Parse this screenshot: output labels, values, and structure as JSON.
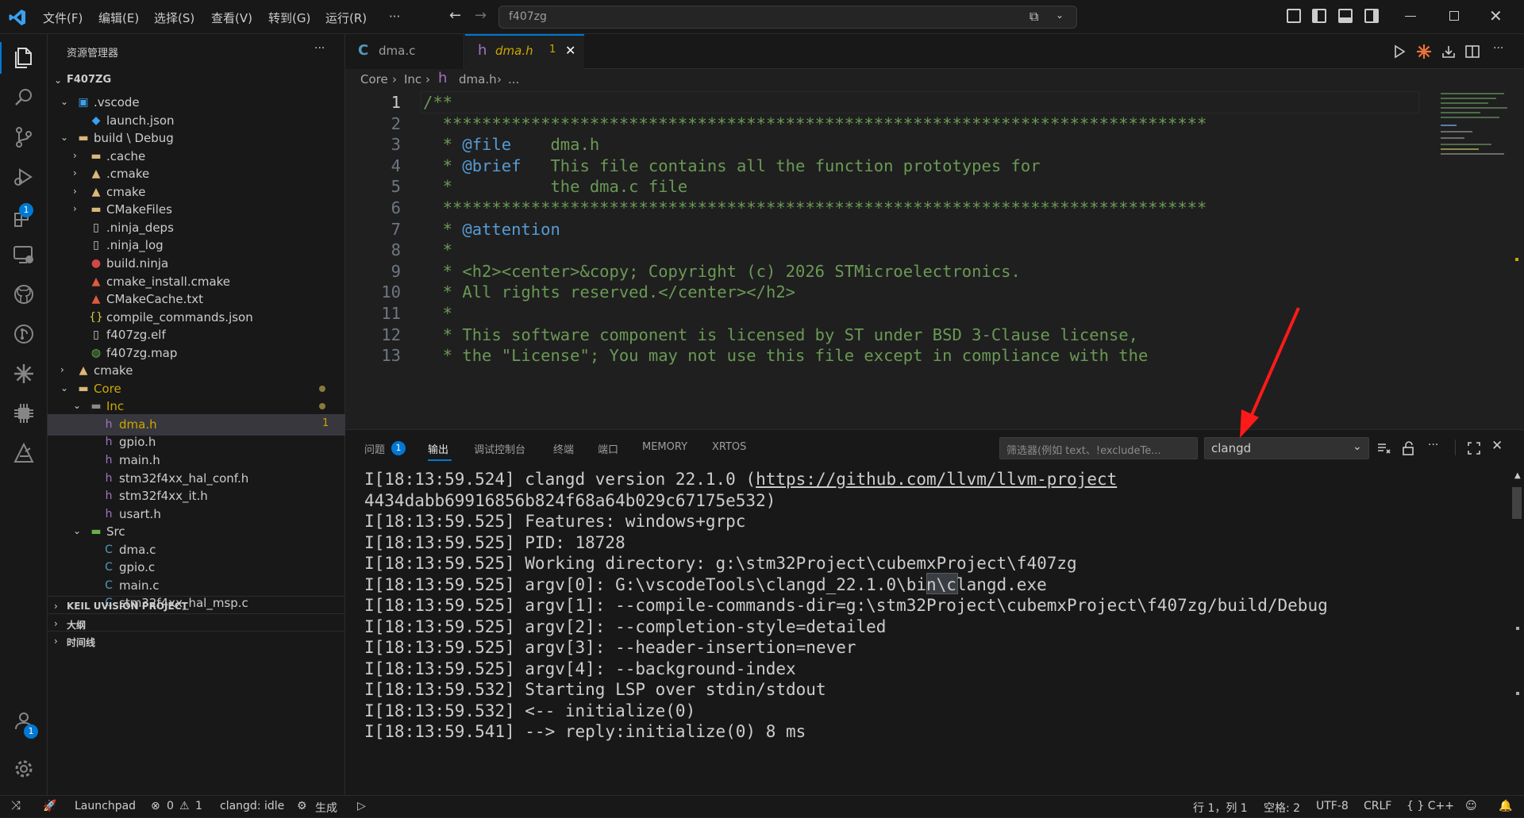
{
  "titlebar": {
    "menus": [
      "文件(F)",
      "编辑(E)",
      "选择(S)",
      "查看(V)",
      "转到(G)",
      "运行(R)",
      "···"
    ],
    "search_text": "f407zg"
  },
  "activity": {
    "extensions_badge": "1",
    "accounts_badge": "1"
  },
  "sidebar": {
    "title": "资源管理器",
    "more": "···",
    "root": "F407ZG",
    "items": [
      {
        "label": ".vscode",
        "depth": 1,
        "chev": "open",
        "icon": "vscode-folder-icon"
      },
      {
        "label": "launch.json",
        "depth": 2,
        "chev": "none",
        "icon": "vscode-file-icon"
      },
      {
        "label": "build \\ Debug",
        "depth": 1,
        "chev": "open",
        "icon": "folder-icon"
      },
      {
        "label": ".cache",
        "depth": 2,
        "chev": "closed",
        "icon": "folder-icon"
      },
      {
        "label": ".cmake",
        "depth": 2,
        "chev": "closed",
        "icon": "cmake-folder-icon"
      },
      {
        "label": "cmake",
        "depth": 2,
        "chev": "closed",
        "icon": "cmake-folder-icon"
      },
      {
        "label": "CMakeFiles",
        "depth": 2,
        "chev": "closed",
        "icon": "folder-icon"
      },
      {
        "label": ".ninja_deps",
        "depth": 2,
        "chev": "none",
        "icon": "file-icon"
      },
      {
        "label": ".ninja_log",
        "depth": 2,
        "chev": "none",
        "icon": "file-icon"
      },
      {
        "label": "build.ninja",
        "depth": 2,
        "chev": "none",
        "icon": "ninja-icon"
      },
      {
        "label": "cmake_install.cmake",
        "depth": 2,
        "chev": "none",
        "icon": "cmake-icon"
      },
      {
        "label": "CMakeCache.txt",
        "depth": 2,
        "chev": "none",
        "icon": "cmake-icon"
      },
      {
        "label": "compile_commands.json",
        "depth": 2,
        "chev": "none",
        "icon": "json-icon"
      },
      {
        "label": "f407zg.elf",
        "depth": 2,
        "chev": "none",
        "icon": "file-icon"
      },
      {
        "label": "f407zg.map",
        "depth": 2,
        "chev": "none",
        "icon": "globe-icon"
      },
      {
        "label": "cmake",
        "depth": 1,
        "chev": "closed",
        "icon": "cmake-folder-icon"
      },
      {
        "label": "Core",
        "depth": 1,
        "chev": "open",
        "icon": "folder-icon",
        "dot": true
      },
      {
        "label": "Inc",
        "depth": 2,
        "chev": "open",
        "icon": "inc-folder-icon",
        "dot": true
      },
      {
        "label": "dma.h",
        "depth": 3,
        "chev": "none",
        "icon": "h-icon",
        "selected": true,
        "count": "1"
      },
      {
        "label": "gpio.h",
        "depth": 3,
        "chev": "none",
        "icon": "h-icon"
      },
      {
        "label": "main.h",
        "depth": 3,
        "chev": "none",
        "icon": "h-icon"
      },
      {
        "label": "stm32f4xx_hal_conf.h",
        "depth": 3,
        "chev": "none",
        "icon": "h-icon"
      },
      {
        "label": "stm32f4xx_it.h",
        "depth": 3,
        "chev": "none",
        "icon": "h-icon"
      },
      {
        "label": "usart.h",
        "depth": 3,
        "chev": "none",
        "icon": "h-icon"
      },
      {
        "label": "Src",
        "depth": 2,
        "chev": "open",
        "icon": "src-folder-icon"
      },
      {
        "label": "dma.c",
        "depth": 3,
        "chev": "none",
        "icon": "c-icon"
      },
      {
        "label": "gpio.c",
        "depth": 3,
        "chev": "none",
        "icon": "c-icon"
      },
      {
        "label": "main.c",
        "depth": 3,
        "chev": "none",
        "icon": "c-icon"
      },
      {
        "label": "stm32f4xx_hal_msp.c",
        "depth": 3,
        "chev": "none",
        "icon": "c-icon"
      }
    ],
    "sections": [
      "KEIL UVISION PROJECT",
      "大纲",
      "时间线"
    ]
  },
  "editor": {
    "tabs": [
      {
        "label": "dma.c",
        "icon": "C",
        "active": false
      },
      {
        "label": "dma.h",
        "icon": "h",
        "active": true,
        "count": "1"
      }
    ],
    "breadcrumb": [
      "Core",
      "Inc",
      "dma.h",
      "..."
    ],
    "lines": [
      {
        "n": "1",
        "text": "/**"
      },
      {
        "n": "2",
        "text": "  ******************************************************************************"
      },
      {
        "n": "3",
        "pre": "  * ",
        "kw": "@file",
        "text": "    dma.h"
      },
      {
        "n": "4",
        "pre": "  * ",
        "kw": "@brief",
        "text": "   This file contains all the function prototypes for"
      },
      {
        "n": "5",
        "text": "  *          the dma.c file"
      },
      {
        "n": "6",
        "text": "  ******************************************************************************"
      },
      {
        "n": "7",
        "pre": "  * ",
        "kw": "@attention",
        "text": ""
      },
      {
        "n": "8",
        "text": "  *"
      },
      {
        "n": "9",
        "text": "  * <h2><center>&copy; Copyright (c) 2026 STMicroelectronics."
      },
      {
        "n": "10",
        "text": "  * All rights reserved.</center></h2>"
      },
      {
        "n": "11",
        "text": "  *"
      },
      {
        "n": "12",
        "text": "  * This software component is licensed by ST under BSD 3-Clause license,"
      },
      {
        "n": "13",
        "text": "  * the \"License\"; You may not use this file except in compliance with the"
      }
    ]
  },
  "panel": {
    "tabs": [
      "问题",
      "输出",
      "调试控制台",
      "终端",
      "端口",
      "MEMORY",
      "XRTOS"
    ],
    "problems_badge": "1",
    "filter_placeholder": "筛选器(例如 text、!excludeTe...",
    "channel": "clangd",
    "more": "···",
    "output": [
      "I[18:13:59.524] clangd version 22.1.0 (https://github.com/llvm/llvm-project",
      "4434dabb69916856b824f68a64b029c67175e532)",
      "I[18:13:59.525] Features: windows+grpc",
      "I[18:13:59.525] PID: 18728",
      "I[18:13:59.525] Working directory: g:\\stm32Project\\cubemxProject\\f407zg",
      "I[18:13:59.525] argv[0]: G:\\vscodeTools\\clangd_22.1.0\\bin\\clangd.exe",
      "I[18:13:59.525] argv[1]: --compile-commands-dir=g:\\stm32Project\\cubemxProject\\f407zg/build/Debug",
      "I[18:13:59.525] argv[2]: --completion-style=detailed",
      "I[18:13:59.525] argv[3]: --header-insertion=never",
      "I[18:13:59.525] argv[4]: --background-index",
      "I[18:13:59.532] Starting LSP over stdin/stdout",
      "I[18:13:59.532] <-- initialize(0)",
      "I[18:13:59.541] --> reply:initialize(0) 8 ms"
    ]
  },
  "status": {
    "launchpad": "Launchpad",
    "errors": "0",
    "warnings": "1",
    "clangd": "clangd: idle",
    "build": "生成",
    "position": "行 1，列 1",
    "spaces": "空格: 2",
    "encoding": "UTF-8",
    "eol": "CRLF",
    "language": "{ } C++"
  },
  "colors": {
    "accent": "#0078d4",
    "arrow": "#ff1a1a",
    "string": "#ce9178",
    "comment": "#6a9955"
  }
}
